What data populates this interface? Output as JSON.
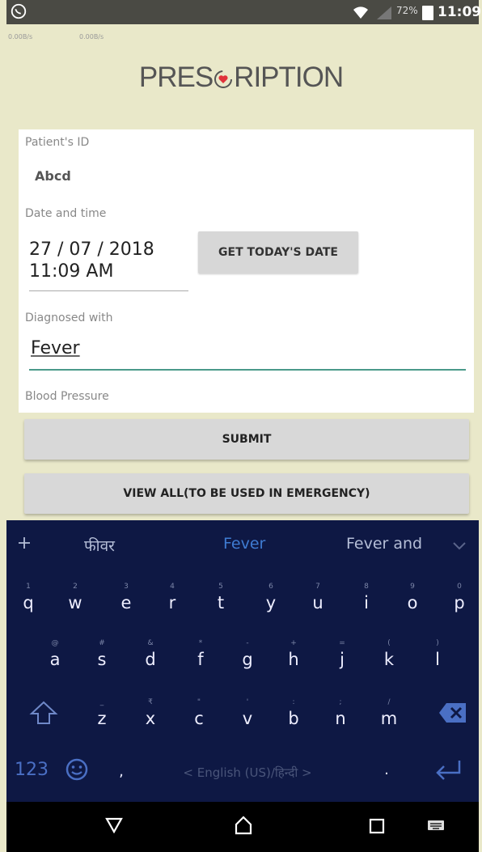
{
  "status_bar": {
    "battery_percent": "72%",
    "time": "11:09"
  },
  "network_speeds": [
    "0.00B/s",
    "0.00B/s"
  ],
  "app": {
    "title": "PRESCRIPTION",
    "accent_color": "#e0323a",
    "background": "#e9e8c9"
  },
  "form": {
    "patient_id_label": "Patient's ID",
    "patient_id_value": "Abcd",
    "date_label": "Date and time",
    "date_value": "27 / 07 / 2018",
    "time_value": "11:09 AM",
    "today_button": "GET TODAY'S DATE",
    "diagnosed_label": "Diagnosed with",
    "diagnosed_value": "Fever",
    "bp_label": "Blood Pressure"
  },
  "buttons": {
    "submit": "SUBMIT",
    "view_all": "VIEW ALL(TO BE USED IN EMERGENCY)"
  },
  "keyboard": {
    "suggestions": [
      "फीवर",
      "Fever",
      "Fever and"
    ],
    "row1": [
      "q",
      "w",
      "e",
      "r",
      "t",
      "y",
      "u",
      "i",
      "o",
      "p"
    ],
    "row1_hints": [
      "1",
      "2",
      "3",
      "4",
      "5",
      "6",
      "7",
      "8",
      "9",
      "0"
    ],
    "row2": [
      "a",
      "s",
      "d",
      "f",
      "g",
      "h",
      "j",
      "k",
      "l"
    ],
    "row2_hints": [
      "@",
      "#",
      "&",
      "*",
      "-",
      "+",
      "=",
      "(",
      ")"
    ],
    "row3": [
      "z",
      "x",
      "c",
      "v",
      "b",
      "n",
      "m"
    ],
    "row3_hints": [
      "_",
      "₹",
      "\"",
      "'",
      ":",
      ";",
      "/"
    ],
    "num_key": "123",
    "comma": ",",
    "language_bar": "< English (US)/हिन्दी >",
    "period": "."
  }
}
